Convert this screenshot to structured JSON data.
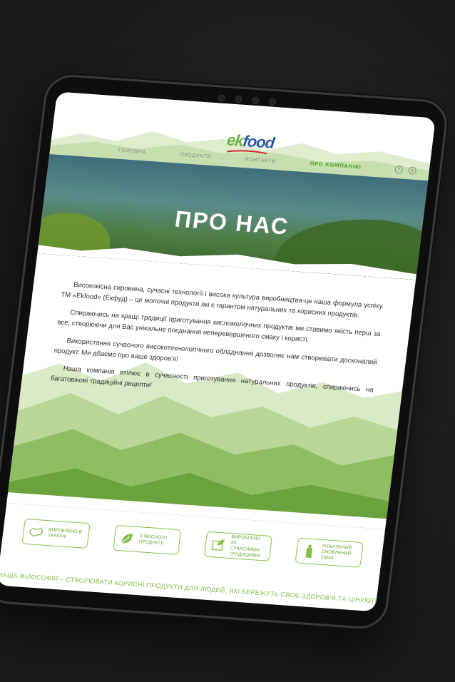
{
  "logo": {
    "part1": "ek",
    "part2": "food"
  },
  "nav": {
    "items": [
      {
        "label": "Головна"
      },
      {
        "label": "Продукти"
      },
      {
        "label": "Контакти"
      },
      {
        "label": "Про компанію"
      }
    ]
  },
  "social": {
    "icons": [
      "facebook-icon",
      "instagram-icon"
    ]
  },
  "hero": {
    "title": "ПРО НАС"
  },
  "content": {
    "paragraphs": [
      "Висококісна сировина, сучасні технології і висока культура виробництва-це наша формула успіху. ТМ «Ekfood» (Екфуд) – це молочні продукти які є гарантом натуральних та корисних продуктів.",
      "Спираючись на кращі традиції приготування кисломолочних продуктів ми ставимо якість перш за все, створюючи для Вас унікальне поєднання неперевершеного смаку і користі.",
      "Використання сучасного високотехнологічного обладнання дозволяє нам створювати досконалий продукт. Ми дбаємо про ваше здоров'я!",
      "Наша компанія втілює в сучасності приготування натуральних продуктів, спираючись на багатовікові традиційні рецепти!"
    ]
  },
  "features": [
    {
      "label": "Вироблено в Україні!",
      "icon": "ukraine-map-icon"
    },
    {
      "label": "З якісного продукту",
      "icon": "leaf-icon"
    },
    {
      "label": "Вироблено за сучасними традиціями",
      "icon": "book-leaf-icon"
    },
    {
      "label": "Унікальний оновлений смак",
      "icon": "bottle-icon"
    }
  ],
  "motto": "Наша філософія – створювати корисні продукти для людей, які бережуть своє здоров'я та цінують натуральний смак",
  "colors": {
    "accent_green": "#86c04b",
    "brand_blue": "#2a5aa8",
    "background": "#1d1d1d"
  }
}
